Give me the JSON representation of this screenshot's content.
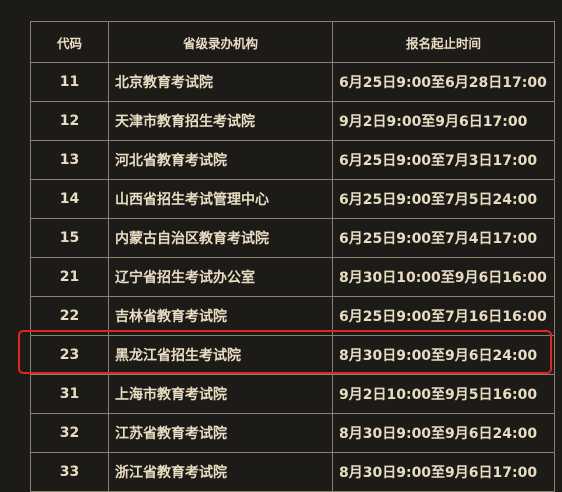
{
  "table": {
    "headers": {
      "code": "代码",
      "org": "省级录办机构",
      "time": "报名起止时间"
    },
    "rows": [
      {
        "code": "11",
        "org": "北京教育考试院",
        "time": "6月25日9:00至6月28日17:00"
      },
      {
        "code": "12",
        "org": "天津市教育招生考试院",
        "time": "9月2日9:00至9月6日17:00"
      },
      {
        "code": "13",
        "org": "河北省教育考试院",
        "time": "6月25日9:00至7月3日17:00"
      },
      {
        "code": "14",
        "org": "山西省招生考试管理中心",
        "time": "6月25日9:00至7月5日24:00"
      },
      {
        "code": "15",
        "org": "内蒙古自治区教育考试院",
        "time": "6月25日9:00至7月4日17:00"
      },
      {
        "code": "21",
        "org": "辽宁省招生考试办公室",
        "time": "8月30日10:00至9月6日16:00"
      },
      {
        "code": "22",
        "org": "吉林省教育考试院",
        "time": "6月25日9:00至7月16日16:00"
      },
      {
        "code": "23",
        "org": "黑龙江省招生考试院",
        "time": "8月30日9:00至9月6日24:00"
      },
      {
        "code": "31",
        "org": "上海市教育考试院",
        "time": "9月2日10:00至9月5日16:00"
      },
      {
        "code": "32",
        "org": "江苏省教育考试院",
        "time": "8月30日9:00至9月6日24:00"
      },
      {
        "code": "33",
        "org": "浙江省教育考试院",
        "time": "8月30日9:00至9月6日17:00"
      }
    ]
  },
  "colors": {
    "background": "#1d1b17",
    "text": "#e8dcc3",
    "border": "#8a8170",
    "highlight": "#e02525"
  }
}
